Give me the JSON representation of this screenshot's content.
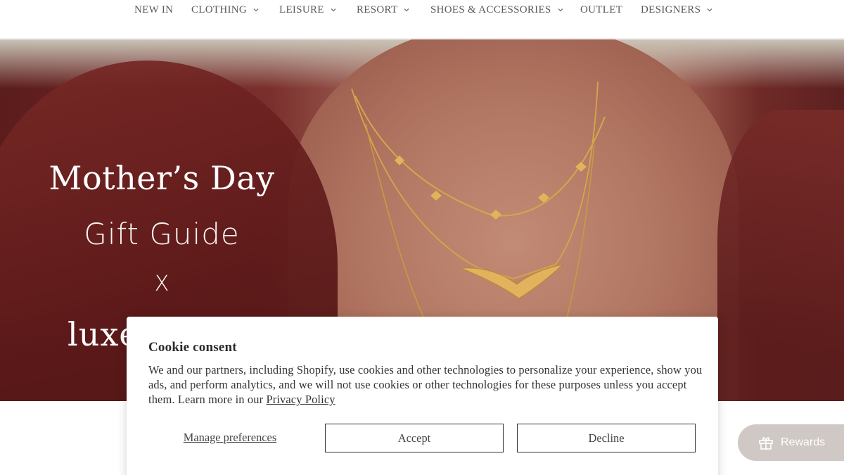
{
  "nav": {
    "items": [
      {
        "label": "NEW IN",
        "has_dropdown": false
      },
      {
        "label": "CLOTHING",
        "has_dropdown": true
      },
      {
        "label": "LEISURE",
        "has_dropdown": true
      },
      {
        "label": "RESORT",
        "has_dropdown": true
      },
      {
        "label": "SHOES & ACCESSORIES",
        "has_dropdown": true
      },
      {
        "label": "OUTLET",
        "has_dropdown": false
      },
      {
        "label": "DESIGNERS",
        "has_dropdown": true
      }
    ]
  },
  "hero": {
    "line1": "Mother’s Day",
    "line2": "Gift Guide",
    "line3": "X",
    "line4": "luxe"
  },
  "cookie": {
    "title": "Cookie consent",
    "body": "We and our partners, including Shopify, use cookies and other technologies to personalize your experience, show you ads, and perform analytics, and we will not use cookies or other technologies for these purposes unless you accept them. Learn more in our ",
    "link": "Privacy Policy",
    "manage": "Manage preferences",
    "accept": "Accept",
    "decline": "Decline"
  },
  "rewards": {
    "label": "Rewards",
    "icon": "gift-icon"
  },
  "colors": {
    "dress": "#5b1c1c",
    "skin": "#b57d69",
    "gold": "#d9a94a",
    "rewards_bg": "#cfc8c4"
  }
}
